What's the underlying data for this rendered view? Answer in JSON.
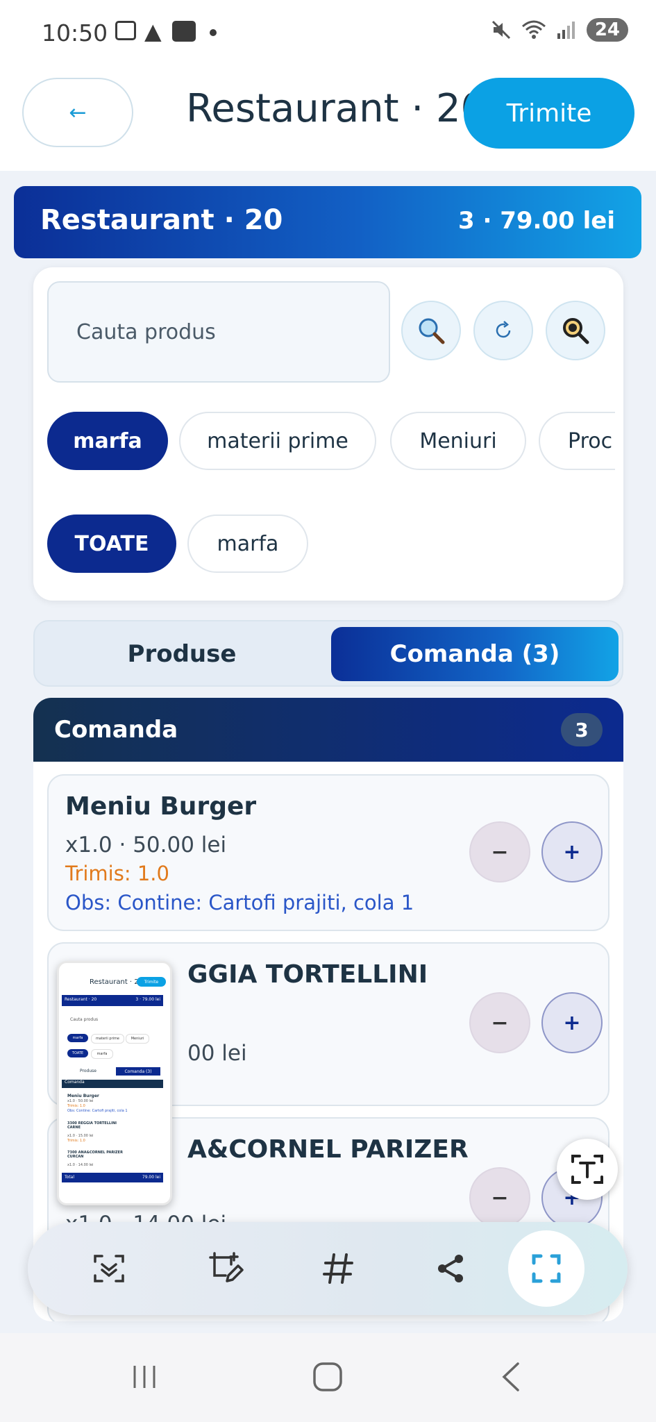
{
  "status_bar": {
    "time": "10:50",
    "battery": "24",
    "icons": [
      "screenshot-icon",
      "warning-icon",
      "emag-icon",
      "dot-icon",
      "mute-icon",
      "wifi-icon",
      "signal-icon"
    ]
  },
  "app_bar": {
    "back_label": "←",
    "title": "Restaurant · 20",
    "send_label": "Trimite"
  },
  "banner": {
    "title": "Restaurant · 20",
    "summary": "3 · 79.00 lei"
  },
  "search": {
    "placeholder": "Cauta produs"
  },
  "categories": [
    {
      "label": "marfa",
      "active": true
    },
    {
      "label": "materii prime",
      "active": false
    },
    {
      "label": "Meniuri",
      "active": false
    },
    {
      "label": "Proc",
      "active": false
    }
  ],
  "subcategories": [
    {
      "label": "TOATE",
      "active": true
    },
    {
      "label": "marfa",
      "active": false
    }
  ],
  "tabs": {
    "products": "Produse",
    "order": "Comanda (3)"
  },
  "order": {
    "title": "Comanda",
    "count": "3",
    "items": [
      {
        "name": "Meniu Burger",
        "qty_price": "x1.0  ·  50.00 lei",
        "sent": "Trimis: 1.0",
        "obs": "Obs: Contine: Cartofi prajiti, cola 1"
      },
      {
        "name": "GGIA TORTELLINI",
        "qty_price": "00 lei"
      },
      {
        "name": "A&CORNEL PARIZER",
        "qty_price": "x1.0  ·  14.00 lei"
      }
    ],
    "minus_label": "−",
    "plus_label": "+"
  },
  "thumbnail": {
    "title": "Restaurant · 20",
    "send": "Trimite",
    "banner_title": "Restaurant · 20",
    "banner_total": "3 · 79.00 lei",
    "search": "Cauta produs",
    "chips": [
      "marfa",
      "materii prime",
      "Meniuri"
    ],
    "subchips": [
      "TOATE",
      "marfa"
    ],
    "tab1": "Produse",
    "tab2": "Comanda (3)",
    "order_title": "Comanda",
    "item1": "Meniu Burger",
    "item1_detail": "x1.0 · 50.00 lei",
    "item1_sent": "Trimis: 1.0",
    "item1_obs": "Obs: Contine: Cartofi prajiti, cola 1",
    "item2": "3300 REGGIA TORTELLINI CARNE",
    "item2_detail": "x1.0 · 15.00 lei",
    "item2_sent": "Trimis: 1.0",
    "item3": "7300 ANA&CORNEL PARIZER CURCAN",
    "item3_detail": "x1.0 · 14.00 lei",
    "total_label": "Total",
    "total_value": "79.00 lei"
  },
  "toolbar": {
    "tools": [
      "scan-text-icon",
      "edit-crop-icon",
      "hashtag-icon",
      "share-icon",
      "screenshot-frame-icon"
    ]
  },
  "nav": {
    "items": [
      "recents-icon",
      "home-icon",
      "back-icon"
    ]
  },
  "colors": {
    "accent": "#0ba1e4",
    "primary_dark": "#0c2a8f",
    "sent_orange": "#e17a1c",
    "obs_blue": "#2a56c8"
  }
}
